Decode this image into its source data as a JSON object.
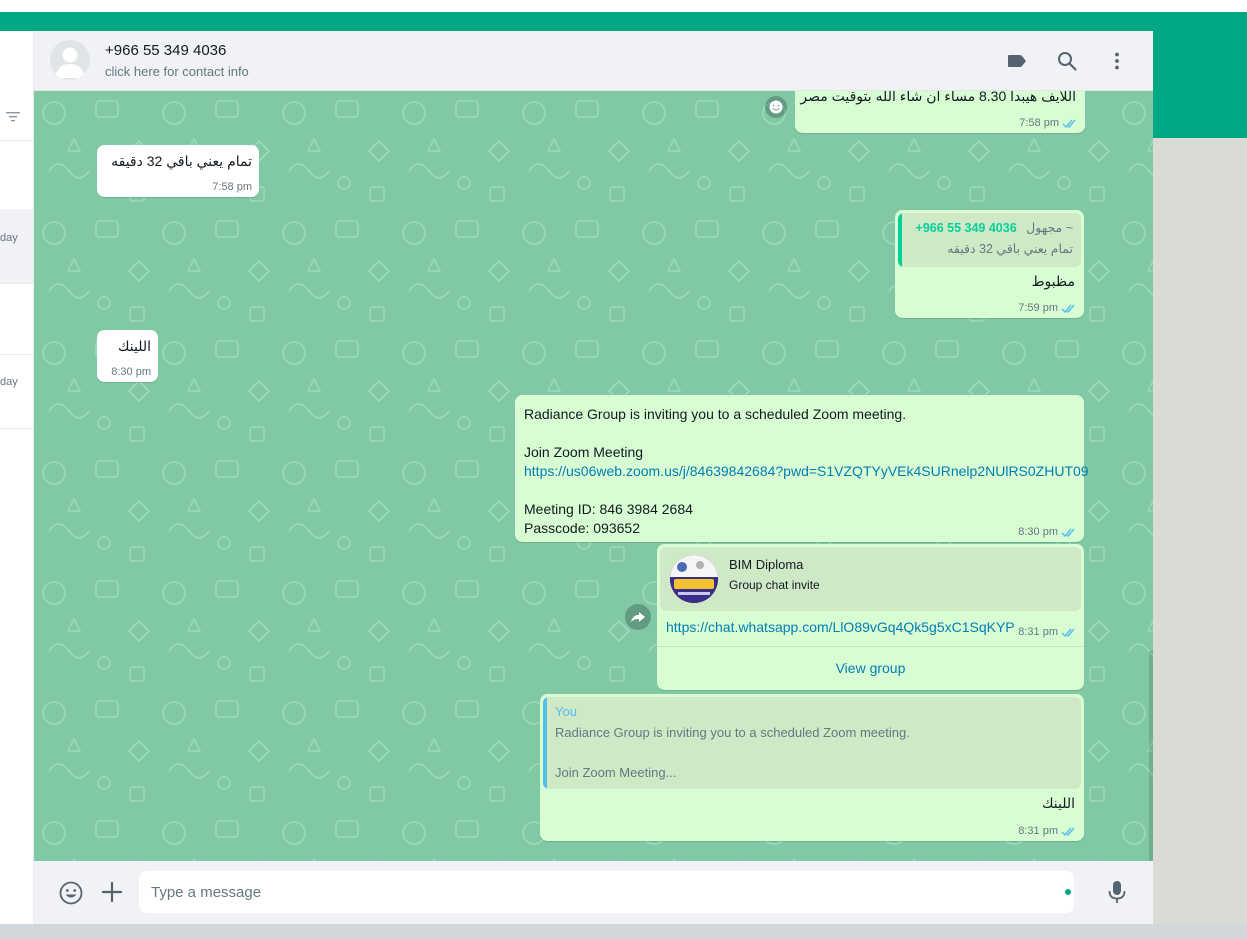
{
  "sidebar": {
    "day_labels": [
      "day",
      "day"
    ]
  },
  "header": {
    "contact_name": "+966 55 349 4036",
    "contact_sub": "click here for contact info"
  },
  "messages": {
    "m0": {
      "text": "اللايف هيبدا 8.30 مساء ان شاء الله بتوقيت مصر",
      "time": "7:58 pm"
    },
    "m1": {
      "text": "تمام يعني باقي 32 دقيقه",
      "time": "7:58 pm"
    },
    "m2": {
      "quote_author": "~ مجهول",
      "quote_phone": "+966 55 349 4036",
      "quote_text": "تمام يعني باقي 32 دقيقه",
      "text": "مظبوط",
      "time": "7:59 pm"
    },
    "m3": {
      "text": "اللينك",
      "time": "8:30 pm"
    },
    "m4": {
      "line1": "Radiance Group is inviting you to a scheduled Zoom meeting.",
      "line2": "Join Zoom Meeting",
      "link": "https://us06web.zoom.us/j/84639842684?pwd=S1VZQTYyVEk4SURnelp2NUlRS0ZHUT09",
      "line3": "Meeting ID: 846 3984 2684",
      "line4": "Passcode: 093652",
      "time": "8:30 pm"
    },
    "m5": {
      "group_name": "BIM Diploma",
      "group_sub": "Group chat invite",
      "link": "https://chat.whatsapp.com/LlO89vGq4Qk5g5xC1SqKYP",
      "time": "8:31 pm",
      "view_group": "View group"
    },
    "m6": {
      "quote_author": "You",
      "quote_line1": "Radiance Group is inviting you to a scheduled Zoom meeting.",
      "quote_line2": "Join Zoom Meeting...",
      "text": "اللينك",
      "time": "8:31 pm"
    }
  },
  "footer": {
    "placeholder": "Type a message"
  },
  "colors": {
    "brand_green": "#00a884",
    "chat_bg": "#80c9a4",
    "outgoing_bubble": "#d9fdd3",
    "incoming_bubble": "#ffffff",
    "link": "#027eb5",
    "read_tick": "#53bdeb"
  }
}
